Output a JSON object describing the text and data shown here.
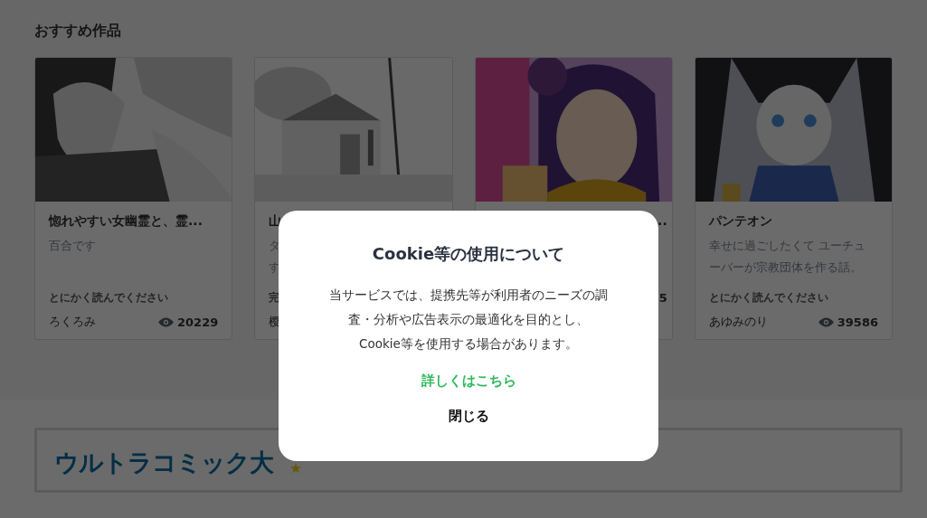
{
  "section": {
    "title": "おすすめ作品"
  },
  "cards": [
    {
      "kind": "full",
      "title": "惚れやすい女幽霊と、霊...",
      "description": [
        "百合です"
      ],
      "tag": "とにかく読んでください",
      "author": "ろくろみ",
      "views": "20229"
    },
    {
      "kind": "covered-right",
      "title": "山",
      "description": [
        "タ",
        "す"
      ],
      "tag": "完",
      "author": "樱"
    },
    {
      "kind": "covered-left",
      "title": "..",
      "views": "5"
    },
    {
      "kind": "full",
      "title": "パンテオン",
      "description": [
        "幸せに過ごしたくて ユーチュ",
        "ーバーが宗教団体を作る話。"
      ],
      "tag": "とにかく読んでください",
      "author": "あゆみのり",
      "views": "39586"
    }
  ],
  "banner": {
    "logo": "ウルトラコミック大"
  },
  "modal": {
    "title": "Cookie等の使用について",
    "body": [
      "当サービスでは、提携先等が利用者のニーズの調",
      "査・分析や広告表示の最適化を目的とし、",
      "Cookie等を使用する場合があります。"
    ],
    "link": "詳しくはこちら",
    "close": "閉じる"
  }
}
